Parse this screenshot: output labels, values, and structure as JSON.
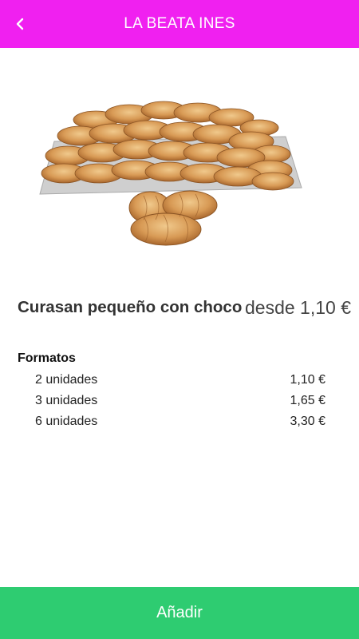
{
  "header": {
    "title": "LA BEATA INES",
    "back_icon": "chevron-left-icon",
    "background_color": "#f020f0"
  },
  "product": {
    "image_icon": "croissant-tray-image",
    "name": "Curasan pequeño con choco",
    "price": "desde 1,10 €"
  },
  "formats": {
    "heading": "Formatos",
    "items": [
      {
        "label": "2 unidades",
        "price": "1,10 €"
      },
      {
        "label": "3 unidades",
        "price": "1,65 €"
      },
      {
        "label": "6 unidades",
        "price": "3,30 €"
      }
    ]
  },
  "footer": {
    "add_label": "Añadir",
    "accent_color": "#2ecc71"
  }
}
